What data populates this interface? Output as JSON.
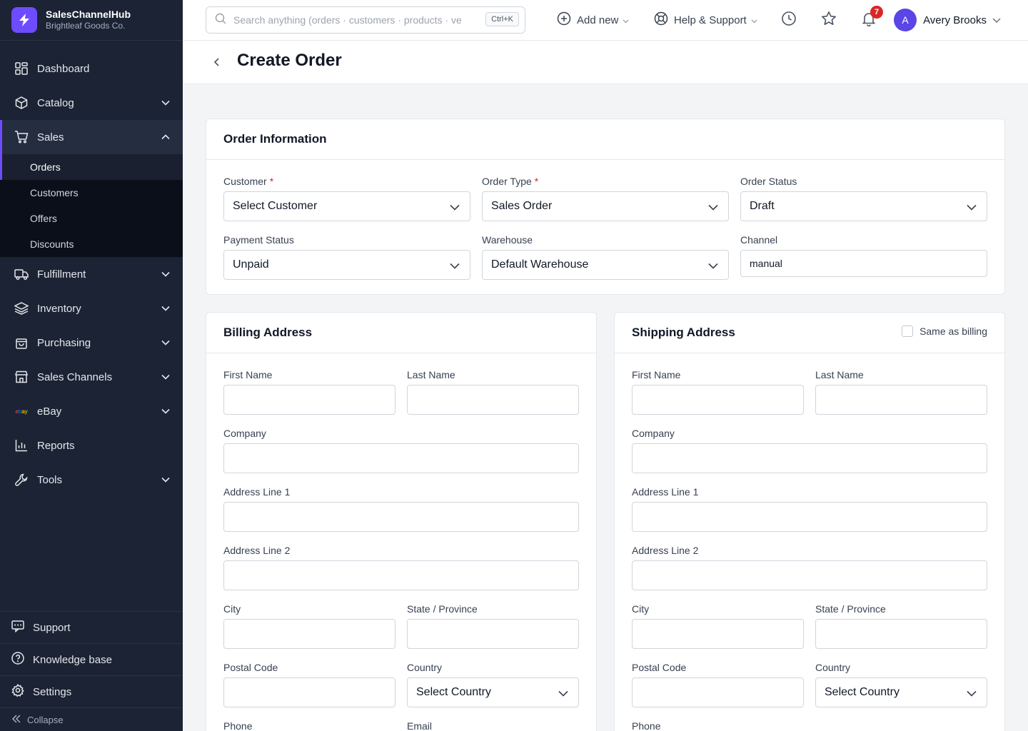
{
  "brand": {
    "name": "SalesChannelHub",
    "subtitle": "Brightleaf Goods Co."
  },
  "sidebar": {
    "items": [
      {
        "label": "Dashboard"
      },
      {
        "label": "Catalog"
      },
      {
        "label": "Sales"
      },
      {
        "label": "Fulfillment"
      },
      {
        "label": "Inventory"
      },
      {
        "label": "Purchasing"
      },
      {
        "label": "Sales Channels"
      },
      {
        "label": "eBay"
      },
      {
        "label": "Reports"
      },
      {
        "label": "Tools"
      }
    ],
    "sales_sub": [
      {
        "label": "Orders"
      },
      {
        "label": "Customers"
      },
      {
        "label": "Offers"
      },
      {
        "label": "Discounts"
      }
    ],
    "bottom": {
      "support": "Support",
      "knowledge": "Knowledge base",
      "settings": "Settings",
      "collapse": "Collapse"
    }
  },
  "topbar": {
    "search_placeholder": "Search anything (orders · customers · products · ve",
    "shortcut": "Ctrl+K",
    "add_new": "Add new",
    "help": "Help & Support",
    "notification_count": "7",
    "user_initial": "A",
    "user_name": "Avery Brooks"
  },
  "page": {
    "title": "Create Order"
  },
  "order_info": {
    "title": "Order Information",
    "customer_label": "Customer",
    "customer_value": "Select Customer",
    "order_type_label": "Order Type",
    "order_type_value": "Sales Order",
    "order_status_label": "Order Status",
    "order_status_value": "Draft",
    "payment_status_label": "Payment Status",
    "payment_status_value": "Unpaid",
    "warehouse_label": "Warehouse",
    "warehouse_value": "Default Warehouse",
    "channel_label": "Channel",
    "channel_value": "manual",
    "required_mark": "*"
  },
  "billing": {
    "title": "Billing Address",
    "first_name": "First Name",
    "last_name": "Last Name",
    "company": "Company",
    "address1": "Address Line 1",
    "address2": "Address Line 2",
    "city": "City",
    "state": "State / Province",
    "postal": "Postal Code",
    "country": "Country",
    "country_value": "Select Country",
    "phone": "Phone",
    "email": "Email"
  },
  "shipping": {
    "title": "Shipping Address",
    "same_as_billing": "Same as billing",
    "first_name": "First Name",
    "last_name": "Last Name",
    "company": "Company",
    "address1": "Address Line 1",
    "address2": "Address Line 2",
    "city": "City",
    "state": "State / Province",
    "postal": "Postal Code",
    "country": "Country",
    "country_value": "Select Country",
    "phone": "Phone"
  },
  "colors": {
    "accent": "#6d4cff",
    "sidebar_bg": "#1c2334",
    "badge": "#dc2626"
  }
}
